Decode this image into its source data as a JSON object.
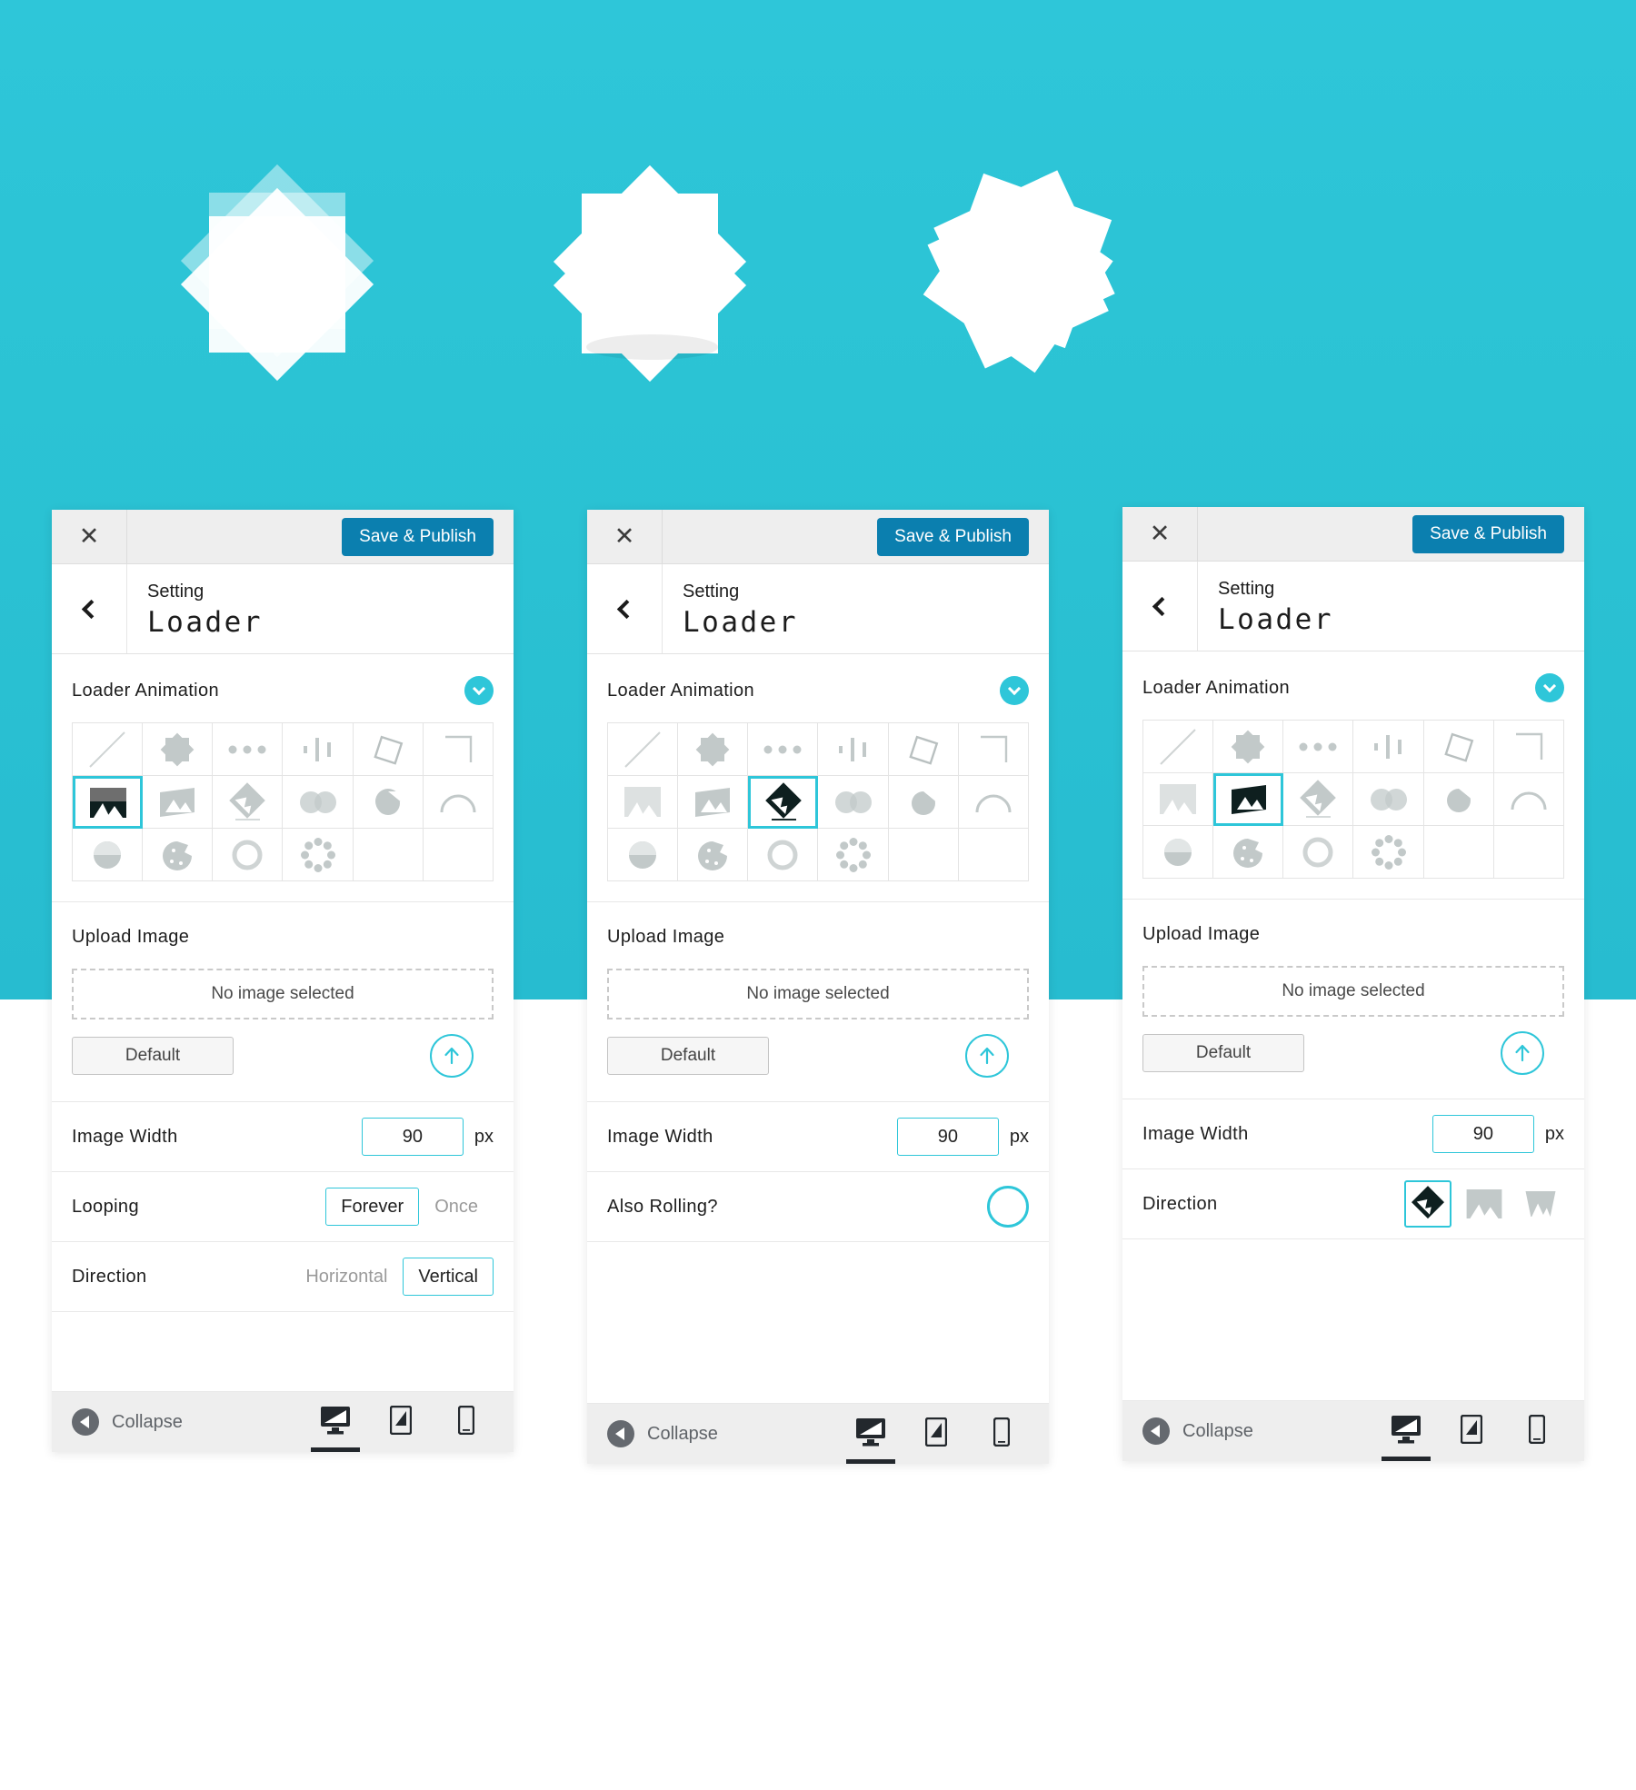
{
  "page": {
    "background_color": "#2ec6d9",
    "accent_color": "#2ec6d9",
    "save_button_color": "#0b7faf"
  },
  "hero": {
    "shapes": [
      {
        "name": "loader-preview-faded",
        "opacity": 0.55
      },
      {
        "name": "loader-preview-bouncing",
        "opacity": 1.0
      },
      {
        "name": "loader-preview-spinning",
        "opacity": 1.0
      }
    ]
  },
  "panels": [
    {
      "id": "panel-1",
      "topbar": {
        "close_label": "✕",
        "save_label": "Save & Publish"
      },
      "breadcrumb": {
        "back_label": "‹",
        "subtitle": "Setting",
        "title": "Loader"
      },
      "loader_animation": {
        "label": "Loader Animation",
        "chevron": "chevron-down-icon",
        "selected_index": 6,
        "icons": [
          "none-diagonal-icon",
          "starburst-icon",
          "three-dots-icon",
          "bars-icon",
          "tilted-square-icon",
          "corner-bracket-icon",
          "image-photo-icon",
          "image-skew-icon",
          "image-diamond-icon",
          "two-circles-icon",
          "pacman-drop-icon",
          "half-arch-icon",
          "half-filled-circle-icon",
          "cookie-icon",
          "ring-icon",
          "flower-ring-icon",
          "",
          ""
        ]
      },
      "upload": {
        "label": "Upload Image",
        "dropzone_text": "No image selected",
        "default_label": "Default",
        "upload_icon": "upload-arrow-icon"
      },
      "rows": [
        {
          "type": "number",
          "label": "Image Width",
          "value": "90",
          "unit": "px"
        },
        {
          "type": "segment",
          "label": "Looping",
          "options": [
            "Forever",
            "Once"
          ],
          "active": "Forever"
        },
        {
          "type": "segment",
          "label": "Direction",
          "options": [
            "Horizontal",
            "Vertical"
          ],
          "active": "Vertical"
        }
      ],
      "footer": {
        "collapse_label": "Collapse",
        "devices": [
          "desktop-icon",
          "tablet-icon",
          "mobile-icon"
        ],
        "active_device": "desktop-icon"
      }
    },
    {
      "id": "panel-2",
      "topbar": {
        "close_label": "✕",
        "save_label": "Save & Publish"
      },
      "breadcrumb": {
        "back_label": "‹",
        "subtitle": "Setting",
        "title": "Loader"
      },
      "loader_animation": {
        "label": "Loader Animation",
        "chevron": "chevron-down-icon",
        "selected_index": 8,
        "icons": [
          "none-diagonal-icon",
          "starburst-icon",
          "three-dots-icon",
          "bars-icon",
          "tilted-square-icon",
          "corner-bracket-icon",
          "image-photo-icon",
          "image-skew-icon",
          "image-diamond-icon",
          "two-circles-icon",
          "pacman-drop-icon",
          "half-arch-icon",
          "half-filled-circle-icon",
          "cookie-icon",
          "ring-icon",
          "flower-ring-icon",
          "",
          ""
        ]
      },
      "upload": {
        "label": "Upload Image",
        "dropzone_text": "No image selected",
        "default_label": "Default",
        "upload_icon": "upload-arrow-icon"
      },
      "rows": [
        {
          "type": "number",
          "label": "Image Width",
          "value": "90",
          "unit": "px"
        },
        {
          "type": "toggle",
          "label": "Also Rolling?",
          "value": "off"
        }
      ],
      "footer": {
        "collapse_label": "Collapse",
        "devices": [
          "desktop-icon",
          "tablet-icon",
          "mobile-icon"
        ],
        "active_device": "desktop-icon"
      }
    },
    {
      "id": "panel-3",
      "topbar": {
        "close_label": "✕",
        "save_label": "Save & Publish"
      },
      "breadcrumb": {
        "back_label": "‹",
        "subtitle": "Setting",
        "title": "Loader"
      },
      "loader_animation": {
        "label": "Loader Animation",
        "chevron": "chevron-down-icon",
        "selected_index": 7,
        "icons": [
          "none-diagonal-icon",
          "starburst-icon",
          "three-dots-icon",
          "bars-icon",
          "tilted-square-icon",
          "corner-bracket-icon",
          "image-photo-icon",
          "image-skew-icon",
          "image-diamond-icon",
          "two-circles-icon",
          "pacman-drop-icon",
          "half-arch-icon",
          "half-filled-circle-icon",
          "cookie-icon",
          "ring-icon",
          "flower-ring-icon",
          "",
          ""
        ]
      },
      "upload": {
        "label": "Upload Image",
        "dropzone_text": "No image selected",
        "default_label": "Default",
        "upload_icon": "upload-arrow-icon"
      },
      "rows": [
        {
          "type": "number",
          "label": "Image Width",
          "value": "90",
          "unit": "px"
        },
        {
          "type": "icons",
          "label": "Direction",
          "icons": [
            "image-diamond-icon",
            "image-photo-grey-icon",
            "image-trapezoid-icon"
          ],
          "active_index": 0
        }
      ],
      "footer": {
        "collapse_label": "Collapse",
        "devices": [
          "desktop-icon",
          "tablet-icon",
          "mobile-icon"
        ],
        "active_device": "desktop-icon"
      }
    }
  ]
}
